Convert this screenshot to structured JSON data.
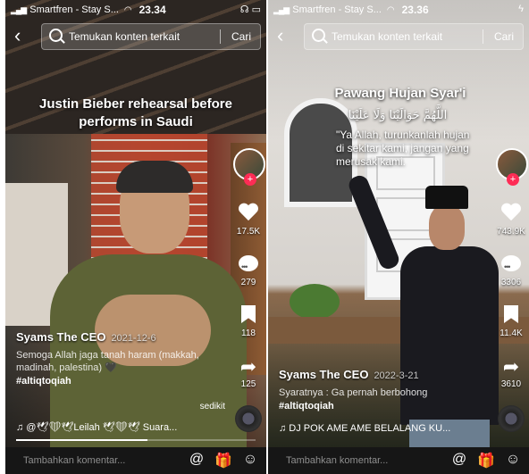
{
  "left": {
    "status": {
      "carrier": "Smartfren - Stay S...",
      "time": "23.34"
    },
    "search": {
      "placeholder": "Temukan konten terkait",
      "button": "Cari"
    },
    "caption": "Justin Bieber rehearsal before performs in Saudi",
    "likes": "17.5K",
    "comments": "279",
    "bookmarks": "118",
    "shares": "125",
    "author": "Syams The CEO",
    "date": "2021-12-6",
    "description": "Semoga Allah jaga tanah haram (makkah, madinah, palestina) 🖤",
    "hashtag": "#altiqtoqiah",
    "more": "sedikit",
    "music": "♫ @🕊❤🕊Leilah 🕊❤🕊 Suara...",
    "progress": 0.55,
    "comment_placeholder": "Tambahkan komentar..."
  },
  "right": {
    "status": {
      "carrier": "Smartfren - Stay S...",
      "time": "23.36"
    },
    "search": {
      "placeholder": "Temukan konten terkait",
      "button": "Cari"
    },
    "caption_title": "Pawang Hujan Syar'i",
    "caption_arabic": "اللَّهُمَّ حَوَالَيْنَا وَلَا عَلَيْنَا",
    "caption_body": "\"Ya Allah, turunkanlah hujan di sekitar kami, jangan yang merusak kami.",
    "likes": "743.9K",
    "comments": "3306",
    "bookmarks": "11.4K",
    "shares": "3610",
    "author": "Syams The CEO",
    "date": "2022-3-21",
    "description": "Syaratnya : Ga pernah berbohong",
    "hashtag": "#altiqtoqiah",
    "music": "♫ DJ POK AME AME BELALANG KU...",
    "comment_placeholder": "Tambahkan komentar..."
  }
}
